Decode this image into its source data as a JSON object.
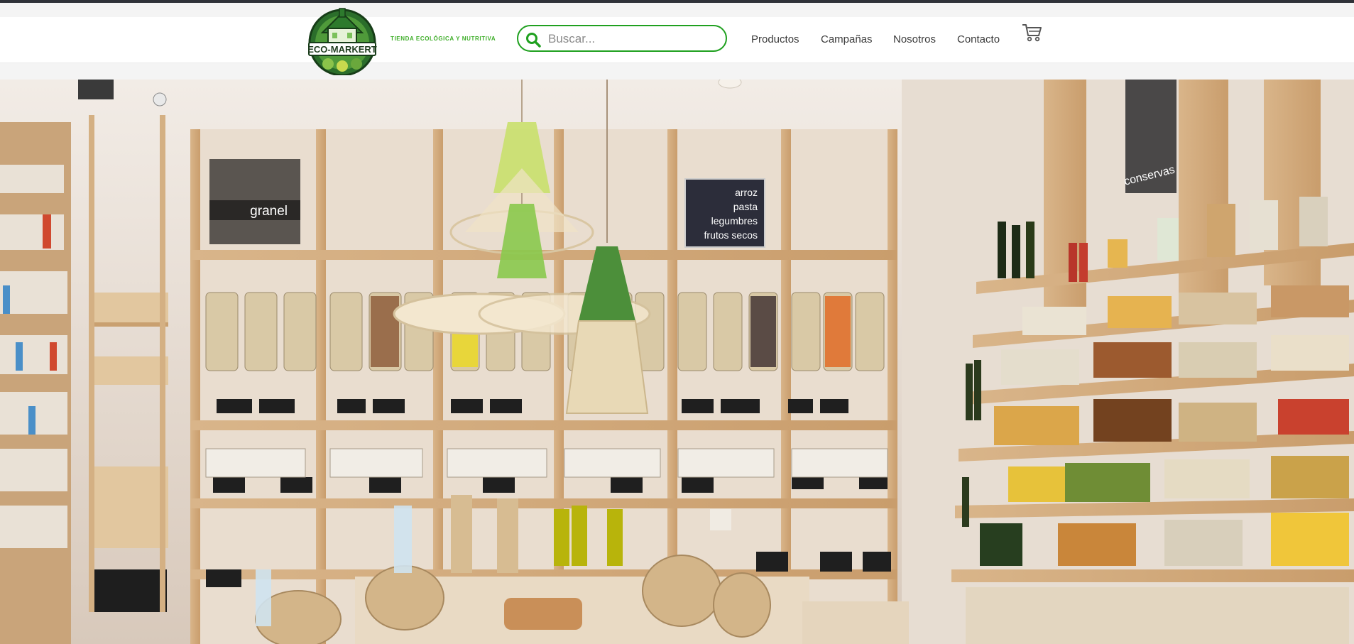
{
  "header": {
    "logo_text": "ECO-MARKERT",
    "tagline": "TIENDA ECOLÓGICA Y NUTRITIVA",
    "search": {
      "placeholder": "Buscar...",
      "value": ""
    },
    "nav": [
      {
        "label": "Productos"
      },
      {
        "label": "Campañas"
      },
      {
        "label": "Nosotros"
      },
      {
        "label": "Contacto"
      }
    ],
    "cart_icon": "shopping-cart-icon"
  },
  "hero": {
    "signs": {
      "granel": "granel",
      "menu": [
        "arroz",
        "pasta",
        "legumbres",
        "frutos secos"
      ],
      "conservas": "conservas"
    }
  },
  "colors": {
    "accent_green": "#1fa01f",
    "tagline_green": "#3fae2a",
    "logo_dark_green": "#1f5d22",
    "topbar": "#2f3238"
  }
}
